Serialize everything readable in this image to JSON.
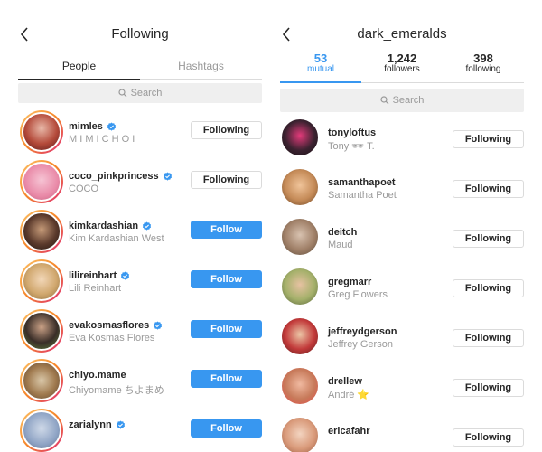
{
  "left": {
    "title": "Following",
    "tabs": [
      "People",
      "Hashtags"
    ],
    "search_placeholder": "Search",
    "rows": [
      {
        "username": "mimles",
        "fullname": "M I M I  C H O I",
        "verified": true,
        "button": "Following",
        "state": "following",
        "avatar": "mimles"
      },
      {
        "username": "coco_pinkprincess",
        "fullname": "COCO",
        "verified": true,
        "button": "Following",
        "state": "following",
        "avatar": "coco"
      },
      {
        "username": "kimkardashian",
        "fullname": "Kim Kardashian West",
        "verified": true,
        "button": "Follow",
        "state": "follow",
        "avatar": "kim"
      },
      {
        "username": "lilireinhart",
        "fullname": "Lili Reinhart",
        "verified": true,
        "button": "Follow",
        "state": "follow",
        "avatar": "lili"
      },
      {
        "username": "evakosmasflores",
        "fullname": "Eva Kosmas Flores",
        "verified": true,
        "button": "Follow",
        "state": "follow",
        "avatar": "eva"
      },
      {
        "username": "chiyo.mame",
        "fullname": "Chiyomame ちよまめ",
        "verified": false,
        "button": "Follow",
        "state": "follow",
        "avatar": "chiyo"
      },
      {
        "username": "zarialynn",
        "fullname": "",
        "verified": true,
        "button": "Follow",
        "state": "follow",
        "avatar": "zaria"
      }
    ]
  },
  "right": {
    "title": "dark_emeralds",
    "stats": [
      {
        "num": "53",
        "label": "mutual",
        "active": true
      },
      {
        "num": "1,242",
        "label": "followers",
        "active": false
      },
      {
        "num": "398",
        "label": "following",
        "active": false
      }
    ],
    "search_placeholder": "Search",
    "rows": [
      {
        "username": "tonyloftus",
        "fullname": "Tony 🕶 T.",
        "button": "Following",
        "avatar": "tony"
      },
      {
        "username": "samanthapoet",
        "fullname": "Samantha Poet",
        "button": "Following",
        "avatar": "sam"
      },
      {
        "username": "deitch",
        "fullname": "Maud",
        "button": "Following",
        "avatar": "deitch"
      },
      {
        "username": "gregmarr",
        "fullname": "Greg Flowers",
        "button": "Following",
        "avatar": "greg"
      },
      {
        "username": "jeffreydgerson",
        "fullname": "Jeffrey Gerson",
        "button": "Following",
        "avatar": "jeff"
      },
      {
        "username": "drellew",
        "fullname": "André ⭐",
        "button": "Following",
        "avatar": "drel"
      },
      {
        "username": "ericafahr",
        "fullname": "",
        "button": "Following",
        "avatar": "erica"
      }
    ]
  },
  "colors": {
    "accent": "#3897f0",
    "border": "#dbdbdb",
    "muted": "#999999",
    "search_bg": "#efefef"
  },
  "icons": {
    "back": "chevron-left-icon",
    "search": "search-icon",
    "verified": "verified-badge-icon"
  }
}
